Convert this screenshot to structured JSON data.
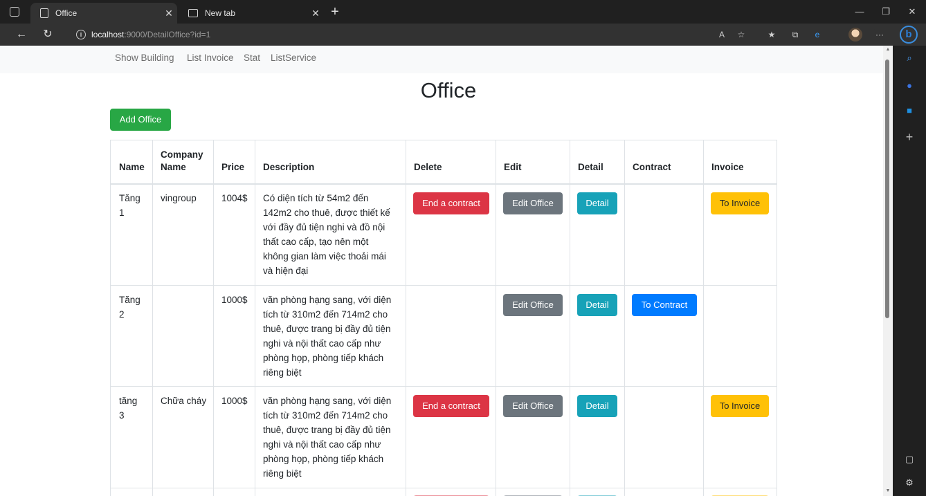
{
  "browser": {
    "tabs": [
      {
        "title": "Office",
        "close": "✕"
      },
      {
        "title": "New tab",
        "close": "✕"
      }
    ],
    "new_tab": "+",
    "url_host": "localhost",
    "url_path": ":9000/DetailOffice?id=1",
    "window_controls": {
      "minimize": "—",
      "restore": "❐",
      "close": "✕"
    },
    "bing_label": "b"
  },
  "nav": {
    "items": [
      "Show Building",
      "List Invoice",
      "Stat",
      "ListService"
    ]
  },
  "page": {
    "title": "Office",
    "add_button": "Add Office"
  },
  "table": {
    "headers": {
      "name": "Name",
      "company_line1": "Company",
      "company_line2": "Name",
      "price": "Price",
      "description": "Description",
      "delete": "Delete",
      "edit": "Edit",
      "detail": "Detail",
      "contract": "Contract",
      "invoice": "Invoice"
    },
    "rows": [
      {
        "name_line1": "Tăng",
        "name_line2": "1",
        "company": "vingroup",
        "price": "1004$",
        "desc_lines": [
          "Có diện tích từ 54m2 đến",
          "142m2 cho thuê, được thiết kế",
          "với đầy đủ tiện nghi và đồ nội",
          "thất cao cấp, tạo nên một",
          "không gian làm việc thoải mái",
          "và hiện đại"
        ],
        "delete": "End a contract",
        "edit": "Edit Office",
        "detail": "Detail",
        "contract": "",
        "invoice": "To Invoice"
      },
      {
        "name_line1": "Tăng",
        "name_line2": "2",
        "company": "",
        "price": "1000$",
        "desc_lines": [
          "văn phòng hạng sang, với diện",
          "tích từ 310m2 đến 714m2 cho",
          "thuê, được trang bị đầy đủ tiện",
          "nghi và nội thất cao cấp như",
          "phòng họp, phòng tiếp khách",
          "riêng biệt"
        ],
        "delete": "",
        "edit": "Edit Office",
        "detail": "Detail",
        "contract": "To Contract",
        "invoice": ""
      },
      {
        "name_line1": "tăng",
        "name_line2": "3",
        "company": "Chữa cháy",
        "price": "1000$",
        "desc_lines": [
          "văn phòng hạng sang, với diện",
          "tích từ 310m2 đến 714m2 cho",
          "thuê, được trang bị đầy đủ tiện",
          "nghi và nội thất cao cấp như",
          "phòng họp, phòng tiếp khách",
          "riêng biệt"
        ],
        "delete": "End a contract",
        "edit": "Edit Office",
        "detail": "Detail",
        "contract": "",
        "invoice": "To Invoice"
      }
    ]
  },
  "colors": {
    "success": "#28a745",
    "danger": "#dc3545",
    "secondary": "#6c757d",
    "info": "#17a2b8",
    "primary": "#007bff",
    "warning": "#ffc107"
  }
}
